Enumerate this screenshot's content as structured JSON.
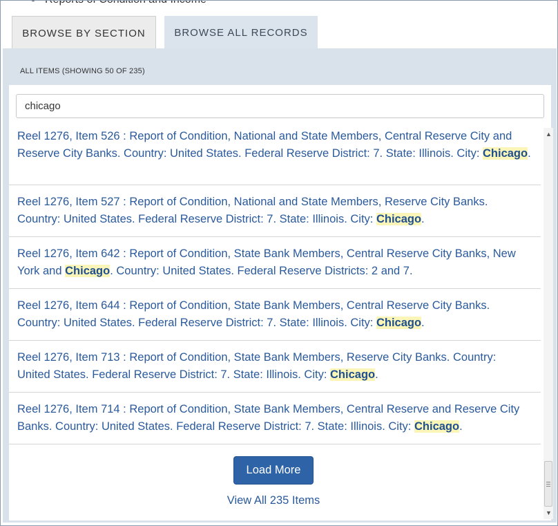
{
  "top_cut_text": "Reports of Condition and Income",
  "tabs": {
    "section": "Browse by Section",
    "all": "Browse All Records"
  },
  "panel": {
    "header": "ALL ITEMS (SHOWING 50 OF 235)"
  },
  "search": {
    "value": "chicago"
  },
  "items": [
    {
      "pre": "Reel 1276, Item 526 : Report of Condition, National and State Members, Central Reserve City and Reserve City Banks. Country: United States. Federal Reserve District: 7. State: Illinois. City: ",
      "highlight": "Chicago",
      "post": "."
    },
    {
      "pre": "Reel 1276, Item 527 : Report of Condition, National and State Members, Reserve City Banks. Country: United States. Federal Reserve District: 7. State: Illinois. City: ",
      "highlight": "Chicago",
      "post": "."
    },
    {
      "pre": "Reel 1276, Item 642 : Report of Condition, State Bank Members, Central Reserve City Banks, New York and ",
      "highlight": "Chicago",
      "post": ". Country: United States. Federal Reserve Districts: 2 and 7."
    },
    {
      "pre": "Reel 1276, Item 644 : Report of Condition, State Bank Members, Central Reserve City Banks. Country: United States. Federal Reserve District: 7. State: Illinois. City: ",
      "highlight": "Chicago",
      "post": "."
    },
    {
      "pre": "Reel 1276, Item 713 : Report of Condition, State Bank Members, Reserve City Banks. Country: United States. Federal Reserve District: 7. State: Illinois. City: ",
      "highlight": "Chicago",
      "post": "."
    },
    {
      "pre": "Reel 1276, Item 714 : Report of Condition, State Bank Members, Central Reserve and Reserve City Banks. Country: United States. Federal Reserve District: 7. State: Illinois. City: ",
      "highlight": "Chicago",
      "post": "."
    }
  ],
  "load_more_label": "Load More",
  "view_all_label": "View All 235 Items",
  "colors": {
    "link": "#2a5a9c",
    "highlight_bg": "#fbf6b8",
    "button": "#2e63a8",
    "panel_bg": "#d9e2eb"
  },
  "icons": {
    "scroll_up": "triangle-up",
    "scroll_down": "triangle-down"
  }
}
